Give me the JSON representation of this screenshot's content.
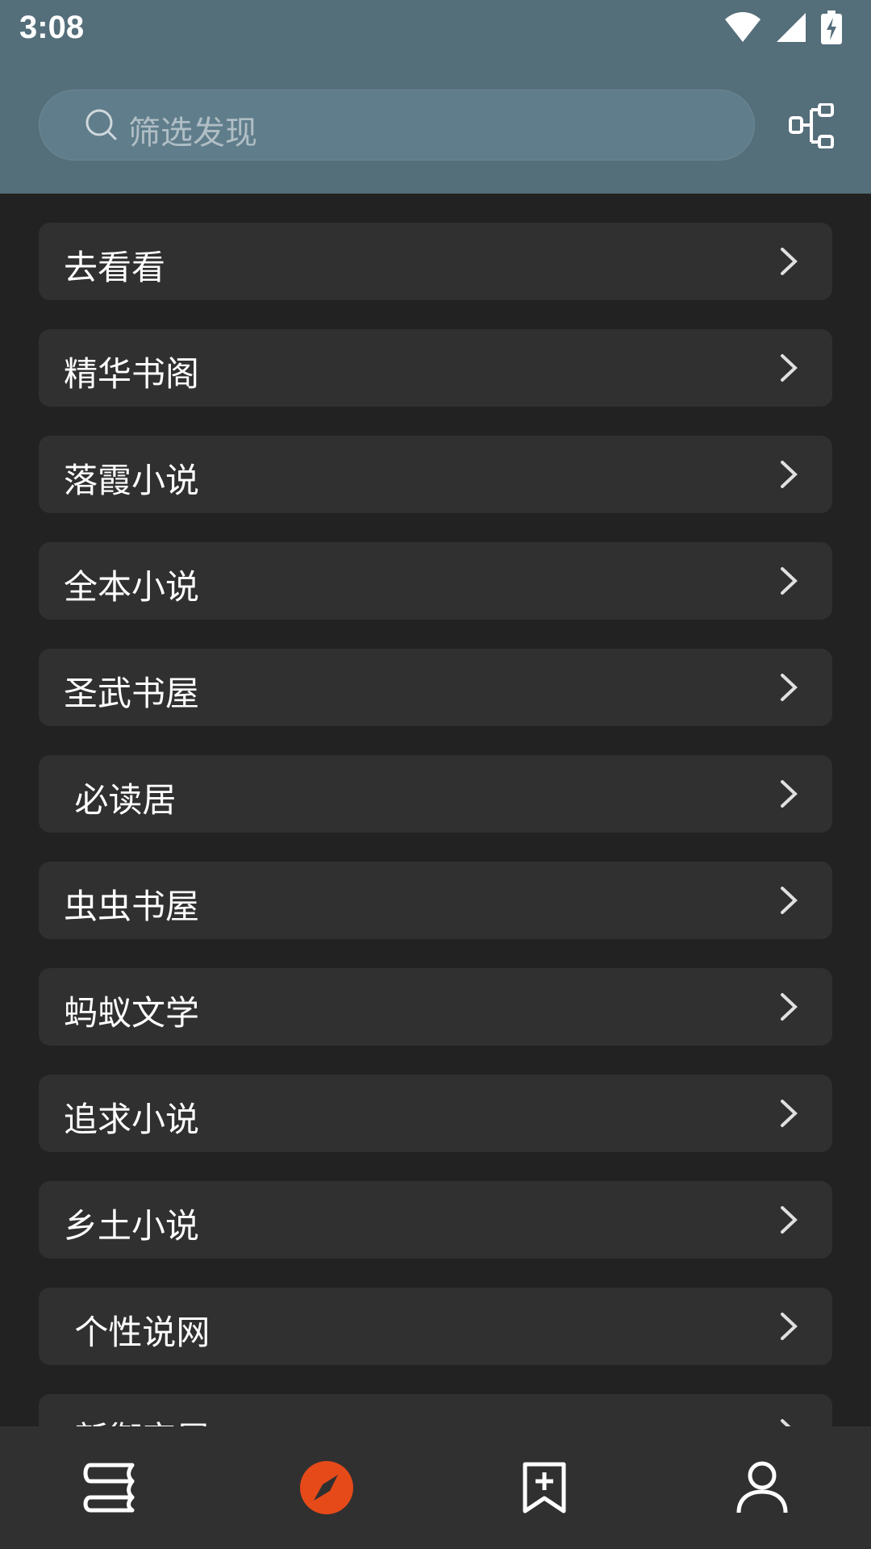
{
  "status_bar": {
    "time": "3:08"
  },
  "search": {
    "placeholder": "筛选发现"
  },
  "items": [
    {
      "label": "去看看"
    },
    {
      "label": "精华书阁"
    },
    {
      "label": "落霞小说"
    },
    {
      "label": "全本小说"
    },
    {
      "label": "圣武书屋"
    },
    {
      "label": " 必读居"
    },
    {
      "label": "虫虫书屋"
    },
    {
      "label": "蚂蚁文学"
    },
    {
      "label": "追求小说"
    },
    {
      "label": "乡土小说"
    },
    {
      "label": " 个性说网"
    },
    {
      "label": " 新御宅屋"
    }
  ],
  "bottom_nav": [
    {
      "icon": "bookshelf-icon",
      "active": false
    },
    {
      "icon": "compass-icon",
      "active": true
    },
    {
      "icon": "bookmark-add-icon",
      "active": false
    },
    {
      "icon": "person-icon",
      "active": false
    }
  ],
  "colors": {
    "header": "#546e7a",
    "accent": "#e64a19",
    "item_bg": "#303030",
    "page_bg": "#222222"
  }
}
